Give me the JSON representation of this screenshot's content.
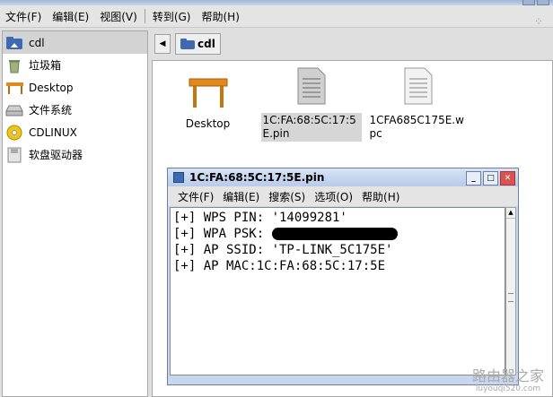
{
  "menubar": {
    "items": [
      "文件(F)",
      "编辑(E)",
      "视图(V)",
      "转到(G)",
      "帮助(H)"
    ]
  },
  "sidebar": {
    "items": [
      {
        "label": "cdl",
        "icon": "home-folder-icon",
        "selected": true
      },
      {
        "label": "垃圾箱",
        "icon": "trash-icon"
      },
      {
        "label": "Desktop",
        "icon": "desktop-table-icon"
      },
      {
        "label": "文件系统",
        "icon": "drive-icon"
      },
      {
        "label": "CDLINUX",
        "icon": "cdrom-icon"
      },
      {
        "label": "软盘驱动器",
        "icon": "floppy-icon"
      }
    ]
  },
  "location": {
    "crumb": "cdl"
  },
  "files": [
    {
      "label": "Desktop",
      "icon": "desktop-table-icon"
    },
    {
      "label": "1C:FA:68:5C:17:5E.pin",
      "icon": "text-document-icon",
      "selected": true
    },
    {
      "label": "1CFA685C175E.wpc",
      "icon": "text-document-icon"
    }
  ],
  "editor": {
    "title": "1C:FA:68:5C:17:5E.pin",
    "menu": [
      "文件(F)",
      "编辑(E)",
      "搜索(S)",
      "选项(O)",
      "帮助(H)"
    ],
    "lines": [
      "[+] WPS PIN: '14099281'",
      "[+] WPA PSK: '",
      "[+] AP SSID: 'TP-LINK_5C175E'",
      "[+] AP MAC:1C:FA:68:5C:17:5E"
    ]
  },
  "watermark": {
    "line1": "路由器之家",
    "line2": "luyouqi520.com"
  },
  "colors": {
    "accent": "#3d6bb3",
    "selection": "#d3d3d3"
  }
}
